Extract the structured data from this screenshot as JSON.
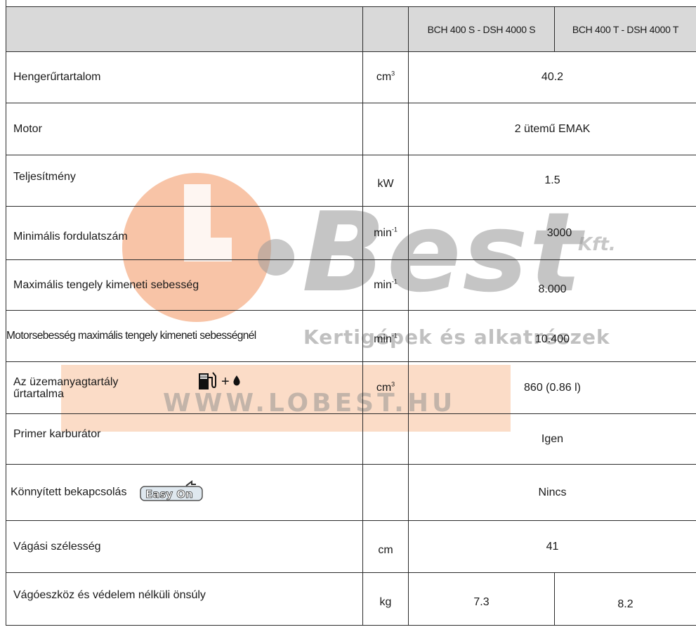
{
  "header": {
    "col_model_1": "BCH 400 S - DSH 4000 S",
    "col_model_2": "BCH 400 T - DSH 4000 T"
  },
  "rows": [
    {
      "label": "Hengerűrtartalom",
      "unit": "cm",
      "unit_sup": "3",
      "value": "40.2"
    },
    {
      "label": "Motor",
      "unit": "",
      "unit_sup": "",
      "value": "2 ütemű EMAK"
    },
    {
      "label": "Teljesítmény",
      "unit": "kW",
      "unit_sup": "",
      "value": "1.5"
    },
    {
      "label": "Minimális fordulatszám",
      "unit": "min",
      "unit_sup": "-1",
      "value": "3000"
    },
    {
      "label": "Maximális tengely kimeneti sebesség",
      "unit": "min",
      "unit_sup": "-1",
      "value": "8.000"
    },
    {
      "label": "Motorsebesség maximális tengely kimeneti sebességnél",
      "unit": "min",
      "unit_sup": "-1",
      "value": "10.400"
    },
    {
      "label": "Az üzemanyagtartály űrtartalma",
      "unit": "cm",
      "unit_sup": "3",
      "value": "860 (0.86 l)",
      "icon_plus": "+"
    },
    {
      "label": "Primer karburátor",
      "unit": "",
      "unit_sup": "",
      "value": "Igen"
    },
    {
      "label": "Könnyített bekapcsolás",
      "unit": "",
      "unit_sup": "",
      "value": "Nincs"
    },
    {
      "label": "Vágási szélesség",
      "unit": "cm",
      "unit_sup": "",
      "value": "41"
    },
    {
      "label": "Vágóeszköz és védelem nélküli önsúly",
      "unit": "kg",
      "unit_sup": "",
      "value_1": "7.3",
      "value_2": "8.2"
    }
  ],
  "watermark": {
    "brand": "Best",
    "suffix": "Kft.",
    "tagline": "Kertigépek és alkatrészek",
    "url": "WWW.LOBEST.HU",
    "colors": {
      "orange": "#f2a06a",
      "gray": "#8a8a8a"
    }
  },
  "icons": {
    "fuel": "fuel-pump-icon",
    "drop": "oil-drop-icon",
    "easy": "easy-on-logo"
  },
  "easy_logo_text": "Easy On"
}
